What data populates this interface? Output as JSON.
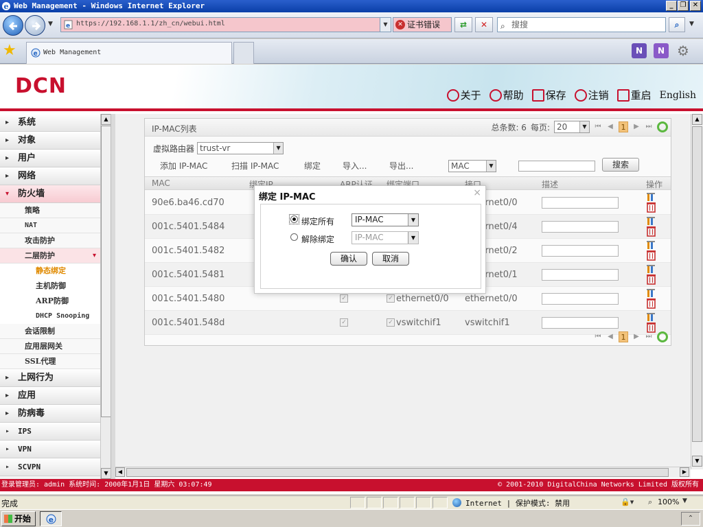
{
  "browser": {
    "title": "Web Management - Windows Internet Explorer",
    "url": "https://192.168.1.1/zh_cn/webui.html",
    "cert_error": "证书错误",
    "search_placeholder": "搜搜",
    "tab_title": "Web Management",
    "status_done": "完成",
    "status_zone": "Internet | 保护模式: 禁用",
    "zoom": "100%",
    "start_label": "开始"
  },
  "header": {
    "logo": "DCN",
    "nav": [
      {
        "label": "关于"
      },
      {
        "label": "帮助"
      },
      {
        "label": "保存"
      },
      {
        "label": "注销"
      },
      {
        "label": "重启"
      }
    ],
    "language": "English"
  },
  "sidebar": {
    "top": [
      "系统",
      "对象",
      "用户",
      "网络"
    ],
    "firewall": "防火墙",
    "firewall_sub": [
      "策略",
      "NAT",
      "攻击防护"
    ],
    "layer2": "二层防护",
    "layer2_sub": [
      "静态绑定",
      "主机防御",
      "ARP防御",
      "DHCP Snooping"
    ],
    "firewall_sub_after": [
      "会话限制",
      "应用层网关",
      "SSL代理"
    ],
    "bottom": [
      "上网行为",
      "应用",
      "防病毒",
      "IPS",
      "VPN",
      "SCVPN"
    ]
  },
  "panel": {
    "title": "IP-MAC列表",
    "total_label": "总条数: 6",
    "per_page_label": "每页:",
    "per_page": "20",
    "page": "1",
    "vrouter_label": "虚拟路由器",
    "vrouter_value": "trust-vr",
    "toolbar": {
      "add": "添加 IP-MAC",
      "scan": "扫描 IP-MAC",
      "bind": "绑定",
      "import": "导入...",
      "export": "导出...",
      "filter_field": "MAC",
      "search": "搜索"
    },
    "columns": [
      "MAC",
      "绑定IP",
      "ARP认证",
      "绑定端口",
      "接口",
      "描述",
      "操作"
    ],
    "rows": [
      {
        "mac": "90e6.ba46.cd70",
        "port": "",
        "iface": "ethernet0/0"
      },
      {
        "mac": "001c.5401.5484",
        "port": "",
        "iface": "ethernet0/4"
      },
      {
        "mac": "001c.5401.5482",
        "port": "",
        "iface": "ethernet0/2"
      },
      {
        "mac": "001c.5401.5481",
        "port": "",
        "iface": "ethernet0/1"
      },
      {
        "mac": "001c.5401.5480",
        "port": "ethernet0/0",
        "iface": "ethernet0/0"
      },
      {
        "mac": "001c.5401.548d",
        "port": "vswitchif1",
        "iface": "vswitchif1"
      }
    ]
  },
  "dialog": {
    "title": "绑定 IP-MAC",
    "close": "×",
    "bind_all_label": "绑定所有",
    "bind_all_value": "IP-MAC",
    "unbind_label": "解除绑定",
    "unbind_value": "IP-MAC",
    "ok": "确认",
    "cancel": "取消"
  },
  "footer": {
    "left": "登录管理员: admin 系统时间: 2000年1月1日 星期六 03:07:49",
    "right": "© 2001-2010 DigitalChina Networks Limited 版权所有"
  },
  "colors": {
    "brand": "#c8102e",
    "accent_selected": "#e08a00"
  }
}
